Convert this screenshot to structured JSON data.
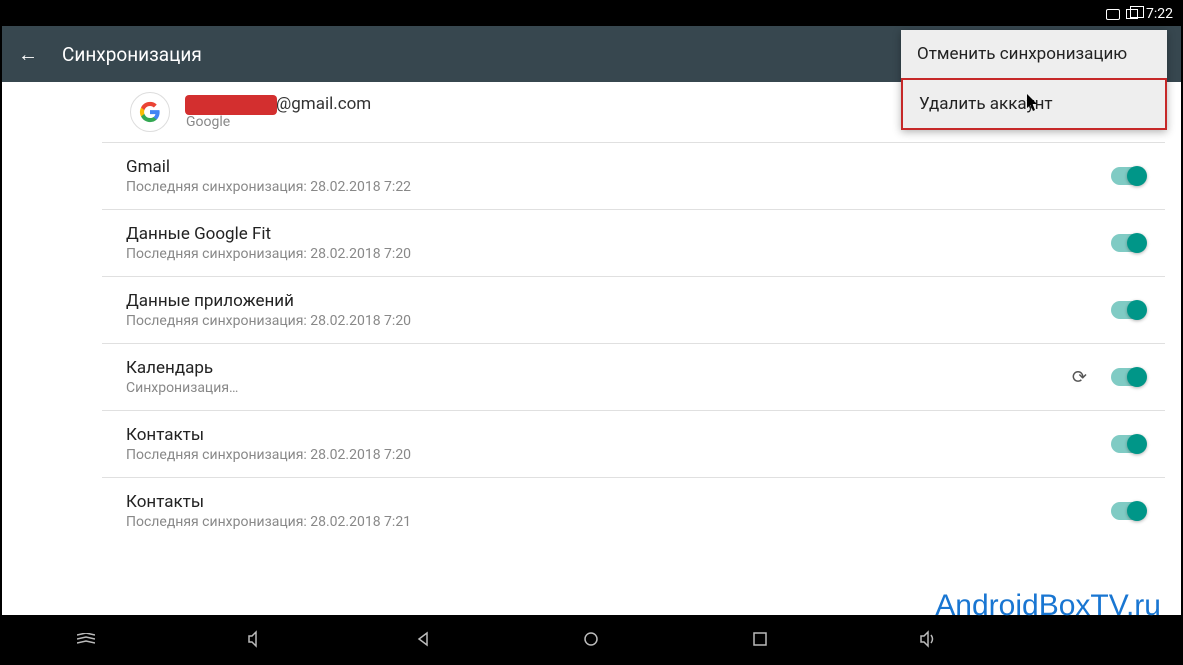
{
  "status_bar": {
    "time": "7:22"
  },
  "app_bar": {
    "title": "Синхронизация"
  },
  "account": {
    "email_suffix": "@gmail.com",
    "provider": "Google"
  },
  "sync_items": [
    {
      "title": "Gmail",
      "subtitle": "Последняя синхронизация: 28.02.2018 7:22",
      "syncing": false
    },
    {
      "title": "Данные Google Fit",
      "subtitle": "Последняя синхронизация: 28.02.2018 7:20",
      "syncing": false
    },
    {
      "title": "Данные приложений",
      "subtitle": "Последняя синхронизация: 28.02.2018 7:20",
      "syncing": false
    },
    {
      "title": "Календарь",
      "subtitle": "Синхронизация…",
      "syncing": true
    },
    {
      "title": "Контакты",
      "subtitle": "Последняя синхронизация: 28.02.2018 7:20",
      "syncing": false
    },
    {
      "title": "Контакты",
      "subtitle": "Последняя синхронизация: 28.02.2018 7:21",
      "syncing": false
    }
  ],
  "menu": {
    "cancel_sync": "Отменить синхронизацию",
    "delete_account": "Удалить аккаунт"
  },
  "watermark": "AndroidBoxTV.ru"
}
